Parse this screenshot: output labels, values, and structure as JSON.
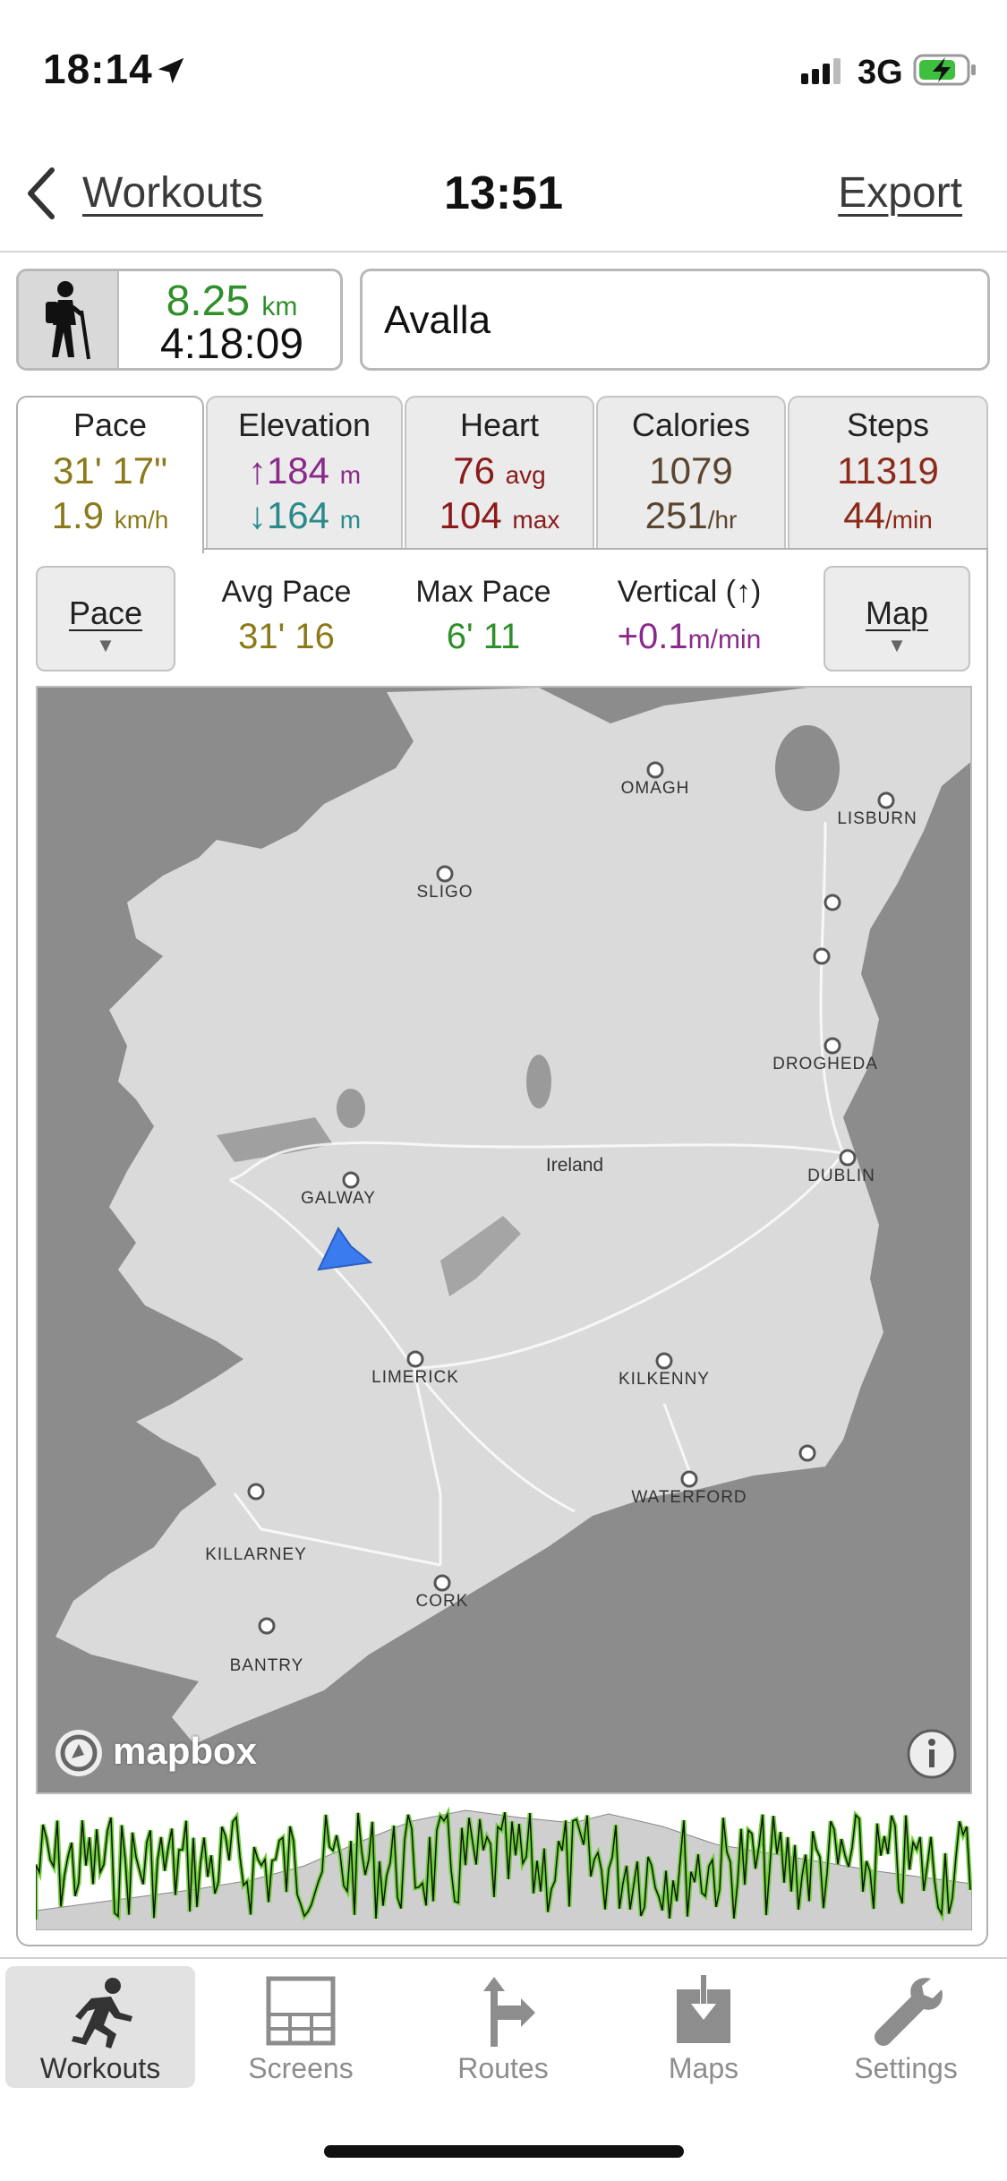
{
  "status_bar": {
    "time": "18:14",
    "network": "3G"
  },
  "nav": {
    "back_label": "Workouts",
    "title": "13:51",
    "export_label": "Export"
  },
  "summary": {
    "distance_value": "8.25",
    "distance_unit": "km",
    "duration": "4:18:09",
    "workout_name": "Avalla"
  },
  "tabs": [
    {
      "label": "Pace",
      "v1": "31' 17\"",
      "v1_unit": "",
      "v2": "1.9",
      "v2_unit": "km/h",
      "color": "#8a7a1a"
    },
    {
      "label": "Elevation",
      "v1": "↑184",
      "v1_unit": "m",
      "v2": "↓164",
      "v2_unit": "m",
      "color1": "#8a2a8a",
      "color2": "#2a8a8a"
    },
    {
      "label": "Heart",
      "v1": "76",
      "v1_unit": "avg",
      "v2": "104",
      "v2_unit": "max",
      "color": "#8b1a1a"
    },
    {
      "label": "Calories",
      "v1": "1079",
      "v1_unit": "",
      "v2": "251",
      "v2_unit": "/hr",
      "color": "#5a4630"
    },
    {
      "label": "Steps",
      "v1": "11319",
      "v1_unit": "",
      "v2": "44",
      "v2_unit": "/min",
      "color": "#8b2a1a"
    }
  ],
  "panel": {
    "left_button": "Pace",
    "right_button": "Map",
    "stats": [
      {
        "label": "Avg Pace",
        "value": "31' 16",
        "unit": "",
        "color": "#8a7a1a"
      },
      {
        "label": "Max Pace",
        "value": "6' 11",
        "unit": "",
        "color": "#2f8f2a"
      },
      {
        "label": "Vertical (↑)",
        "value": "+0.1",
        "unit": "m/min",
        "color": "#8a2a8a"
      }
    ]
  },
  "map": {
    "attribution": "mapbox",
    "region_label": "Ireland",
    "cities": [
      "OMAGH",
      "LISBURN",
      "SLIGO",
      "DROGHEDA",
      "DUBLIN",
      "GALWAY",
      "LIMERICK",
      "KILKENNY",
      "WATERFORD",
      "KILLARNEY",
      "CORK",
      "BANTRY"
    ]
  },
  "tab_bar": [
    {
      "label": "Workouts",
      "icon": "runner-icon",
      "active": true
    },
    {
      "label": "Screens",
      "icon": "screens-grid-icon",
      "active": false
    },
    {
      "label": "Routes",
      "icon": "route-signpost-icon",
      "active": false
    },
    {
      "label": "Maps",
      "icon": "map-download-icon",
      "active": false
    },
    {
      "label": "Settings",
      "icon": "wrench-icon",
      "active": false
    }
  ]
}
